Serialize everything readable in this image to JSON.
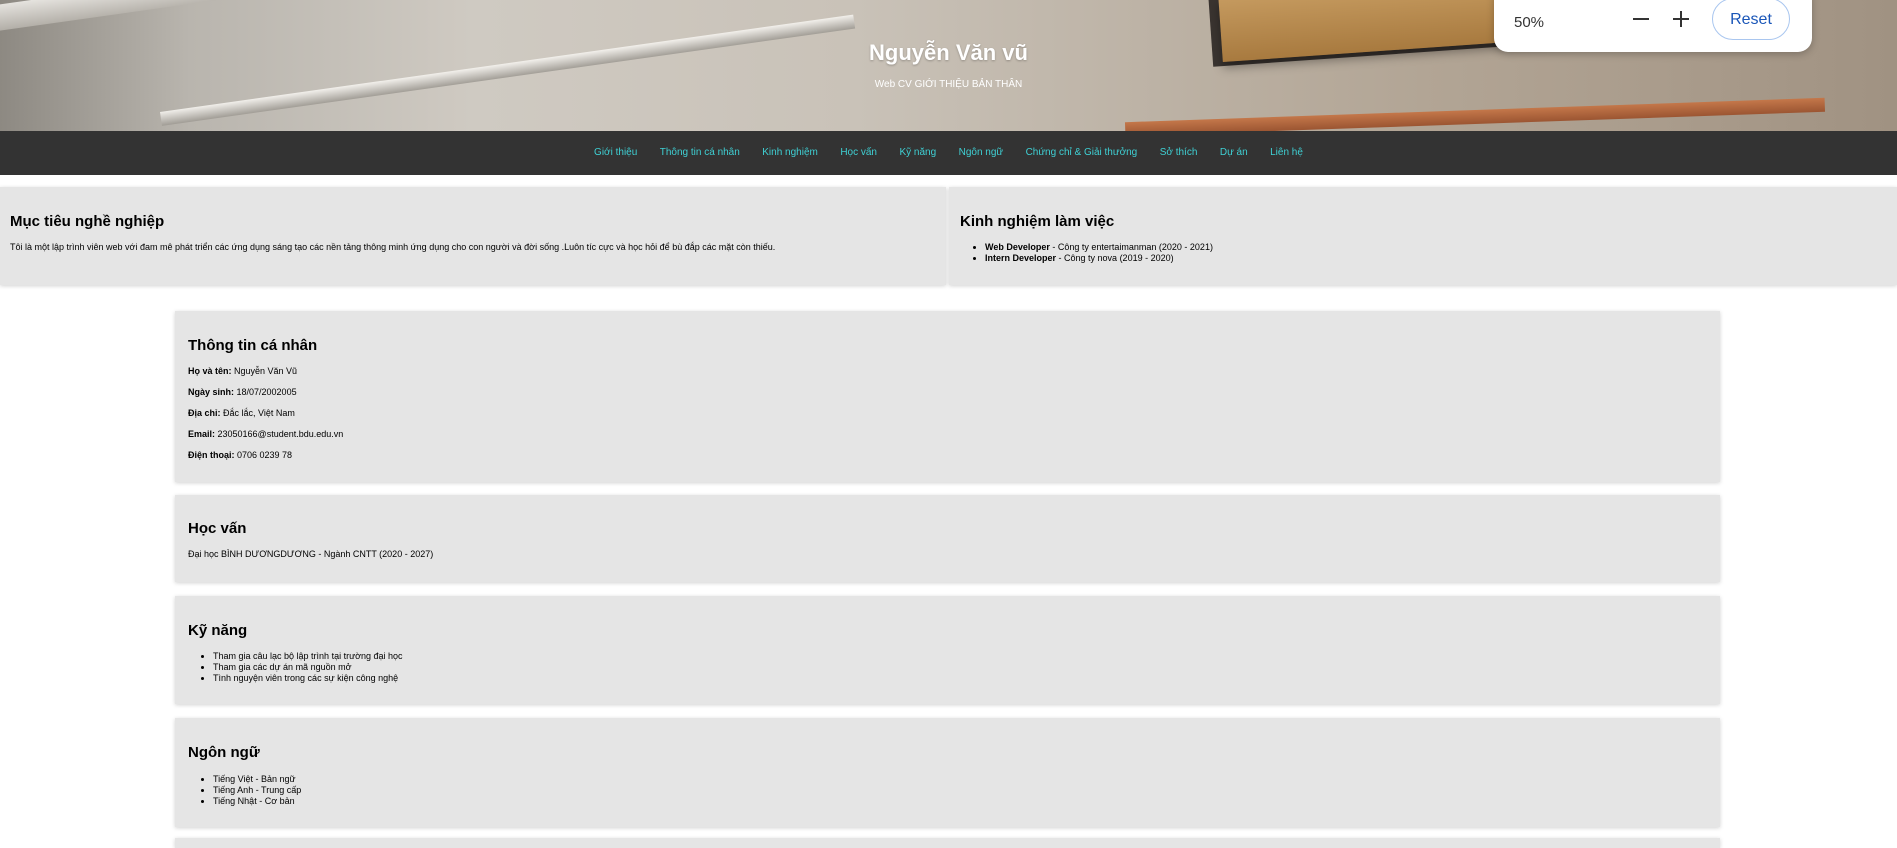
{
  "header": {
    "title": "Nguyễn Văn vũ",
    "subtitle": "Web CV GIỚI THIỆU BẢN THÂN"
  },
  "zoom_popup": {
    "value": "50%",
    "minus_icon": "minus-icon",
    "plus_icon": "plus-icon",
    "reset_label": "Reset",
    "accent_color": "#1a56b8"
  },
  "nav": {
    "items": [
      "Giới thiệu",
      "Thông tin cá nhân",
      "Kinh nghiệm",
      "Học vấn",
      "Kỹ năng",
      "Ngôn ngữ",
      "Chứng chỉ & Giải thưởng",
      "Sở thích",
      "Dự án",
      "Liên hệ"
    ],
    "link_color": "#3fd0d4",
    "bg_color": "#333333"
  },
  "goal": {
    "title": "Mục tiêu nghề nghiệp",
    "text": "Tôi là một lập trình viên web với đam mê phát triển các ứng dụng sáng tạo các nền tảng thông minh ứng dụng cho con người và đời sống .Luôn tíc cực và học hỏi để bù đắp các mặt còn thiếu."
  },
  "experience": {
    "title": "Kinh nghiệm làm việc",
    "items": [
      {
        "role": "Web Developer",
        "detail": " - Công ty entertaimanman (2020 - 2021)"
      },
      {
        "role": "Intern Developer",
        "detail": " - Công ty nova (2019 - 2020)"
      }
    ]
  },
  "personal": {
    "title": "Thông tin cá nhân",
    "fields": [
      {
        "label": "Họ và tên:",
        "value": " Nguyễn Văn Vũ"
      },
      {
        "label": "Ngày sinh:",
        "value": " 18/07/2002005"
      },
      {
        "label": "Địa chỉ:",
        "value": " Đắc lắc, Việt Nam"
      },
      {
        "label": "Email:",
        "value": " 23050166@student.bdu.edu.vn"
      },
      {
        "label": "Điện thoại:",
        "value": " 0706 0239 78"
      }
    ]
  },
  "education": {
    "title": "Học vấn",
    "text": "Đại học BÌNH DƯƠNGDƯƠNG - Ngành CNTT (2020 - 2027)"
  },
  "skills": {
    "title": "Kỹ năng",
    "items": [
      "Tham gia câu lạc bộ lập trình tại trường đại học",
      "Tham gia các dự án mã nguồn mở",
      "Tình nguyện viên trong các sự kiện công nghệ"
    ]
  },
  "languages": {
    "title": "Ngôn ngữ",
    "items": [
      "Tiếng Việt - Bản ngữ",
      "Tiếng Anh - Trung cấp",
      "Tiếng Nhật - Cơ bản"
    ]
  }
}
